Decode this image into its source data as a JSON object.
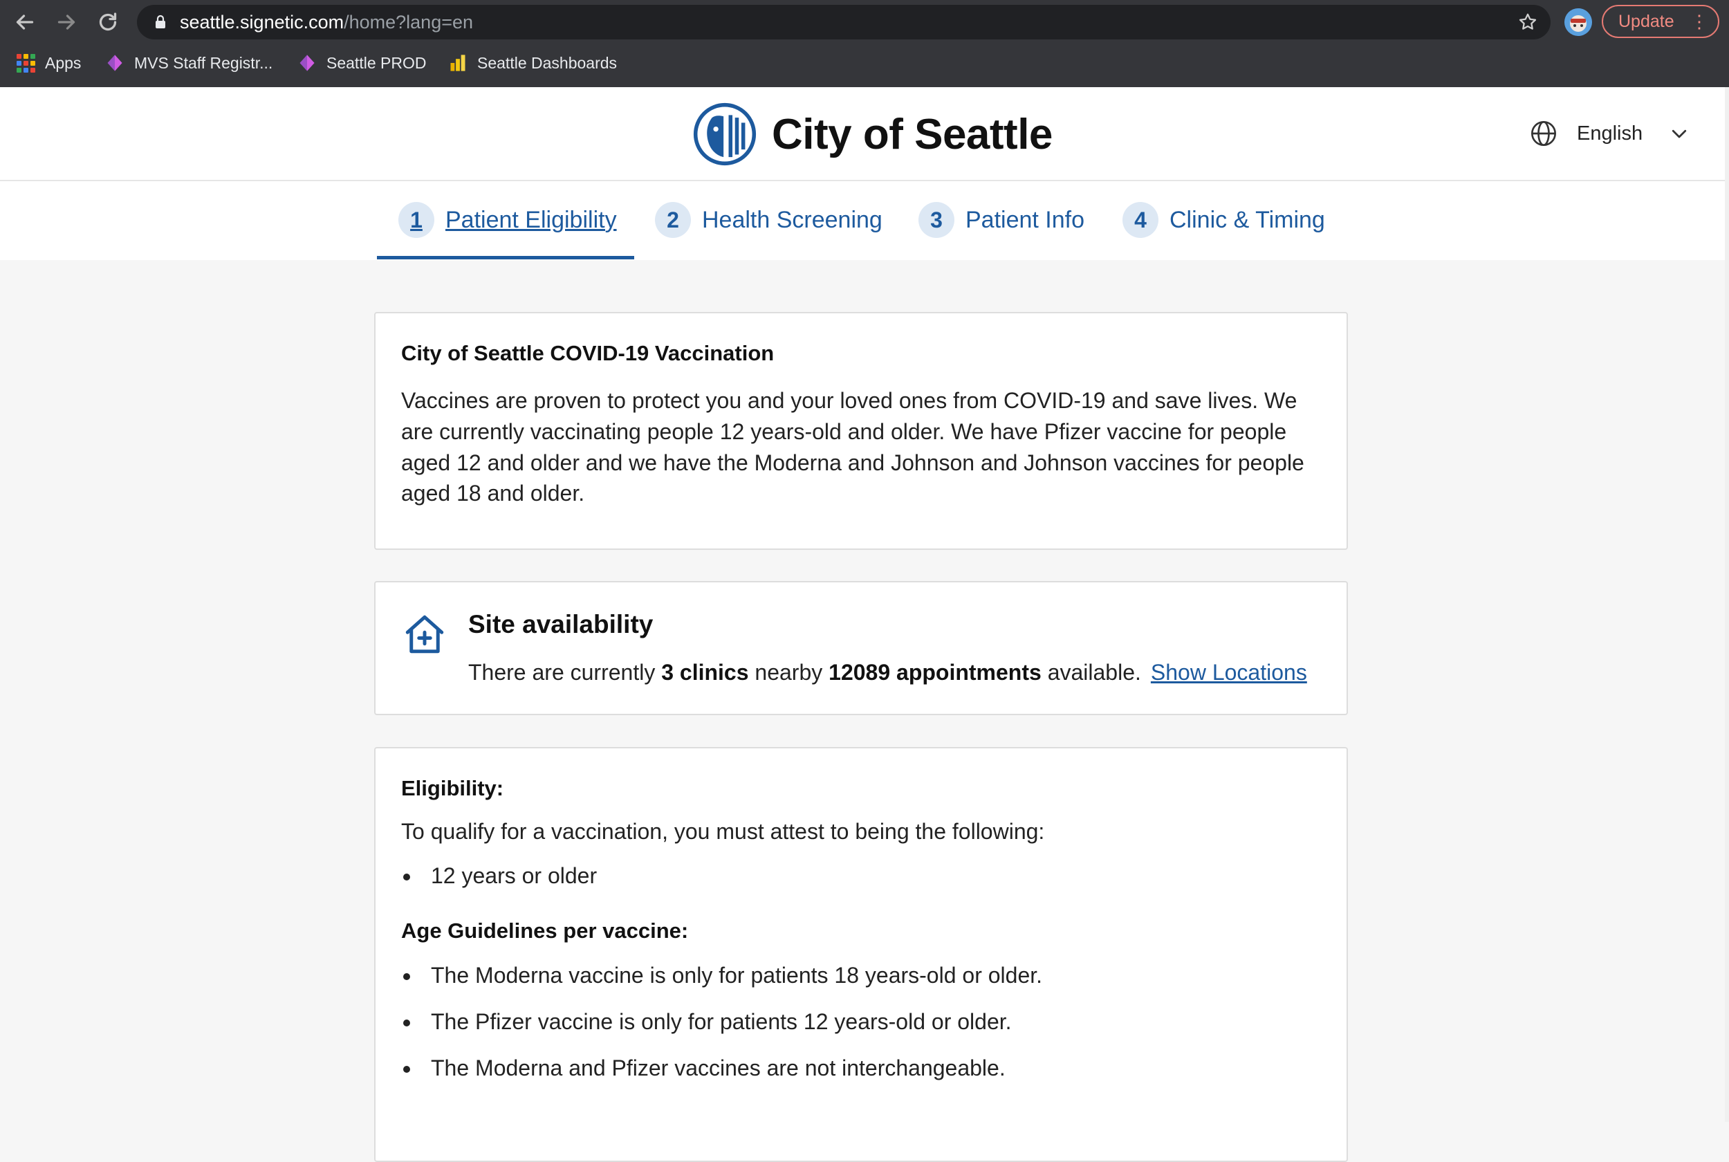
{
  "browser": {
    "url_host": "seattle.signetic.com",
    "url_path": "/home?lang=en",
    "update_label": "Update",
    "bookmarks": [
      {
        "label": "Apps",
        "icon": "apps-grid-icon"
      },
      {
        "label": "MVS Staff Registr...",
        "icon": "powerapps-icon"
      },
      {
        "label": "Seattle PROD",
        "icon": "powerapps-icon"
      },
      {
        "label": "Seattle Dashboards",
        "icon": "powerbi-icon"
      }
    ]
  },
  "header": {
    "site_title": "City of Seattle",
    "language": "English"
  },
  "steps": [
    {
      "num": "1",
      "label": "Patient Eligibility",
      "active": true
    },
    {
      "num": "2",
      "label": "Health Screening",
      "active": false
    },
    {
      "num": "3",
      "label": "Patient Info",
      "active": false
    },
    {
      "num": "4",
      "label": "Clinic & Timing",
      "active": false
    }
  ],
  "intro": {
    "title": "City of Seattle COVID-19 Vaccination",
    "body": "Vaccines are proven to protect you and your loved ones from COVID-19 and save lives. We are currently vaccinating people 12 years-old and older. We have Pfizer vaccine for people aged 12 and older and we have the Moderna and Johnson and Johnson vaccines for people aged 18 and older."
  },
  "site": {
    "title": "Site availability",
    "text_1": "There are currently ",
    "clinics": "3 clinics",
    "text_2": " nearby ",
    "appointments": "12089 appointments",
    "text_3": " available.",
    "link": "Show Locations"
  },
  "eligibility": {
    "heading": "Eligibility:",
    "intro": "To qualify for a vaccination, you must attest to being the following:",
    "items": [
      "12 years or older"
    ],
    "age_heading": "Age Guidelines per vaccine:",
    "age_items": [
      "The Moderna vaccine is only for patients 18 years-old or older.",
      "The Pfizer vaccine is only for patients 12 years-old or older.",
      "The Moderna and Pfizer vaccines are not interchangeable."
    ]
  },
  "colors": {
    "accent": "#1d5a9e",
    "chrome_bg": "#35363a",
    "page_bg": "#f6f6f6"
  }
}
